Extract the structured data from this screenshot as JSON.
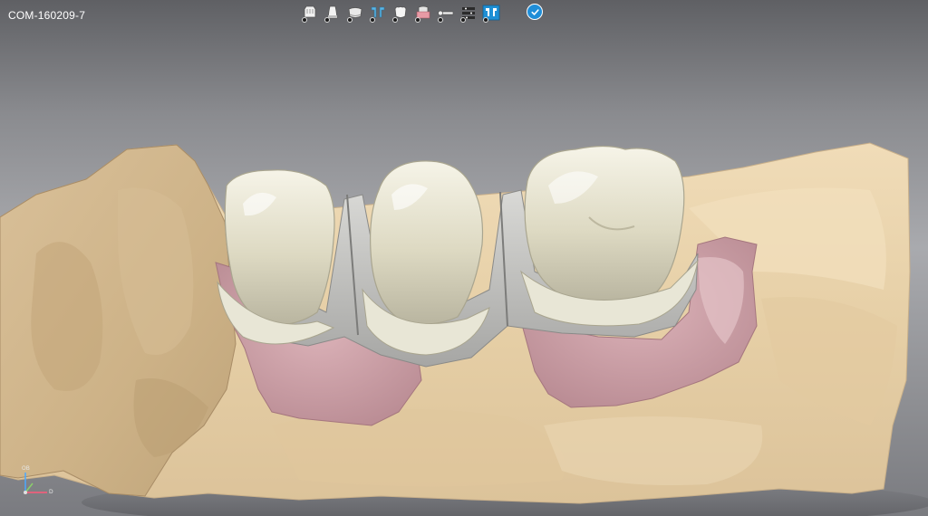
{
  "case_title": "COM-160209-7",
  "toolbar": {
    "tools": [
      {
        "name": "model-icon"
      },
      {
        "name": "die-icon"
      },
      {
        "name": "margin-icon"
      },
      {
        "name": "insertion-axis-icon"
      },
      {
        "name": "crown-icon"
      },
      {
        "name": "gingiva-icon"
      },
      {
        "name": "connector-icon"
      },
      {
        "name": "settings-icon"
      },
      {
        "name": "bridge-icon"
      }
    ],
    "confirm_icon": "checkmark-icon"
  },
  "axes": {
    "top_label": "OB",
    "right_label": "D"
  },
  "colors": {
    "crown": "#e4e0cc",
    "model": "#e8d4ae",
    "gingiva": "#c59aa3",
    "accent": "#1f8ed8"
  }
}
